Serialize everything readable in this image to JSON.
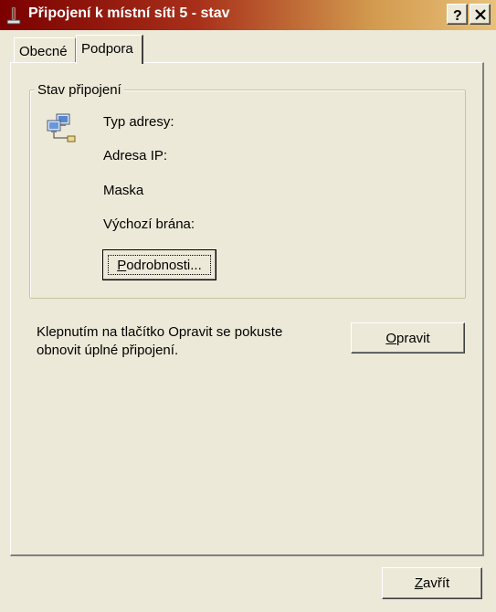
{
  "window": {
    "title": "Připojení k místní síti 5 - stav",
    "help_button": "?",
    "icon": "network-connection-icon"
  },
  "tabs": [
    {
      "label": "Obecné",
      "active": false
    },
    {
      "label": "Podpora",
      "active": true
    }
  ],
  "connection_status": {
    "group_title": "Stav připojení",
    "icon": "network-computers-icon",
    "fields": [
      {
        "label": "Typ adresy:"
      },
      {
        "label": "Adresa IP:"
      },
      {
        "label": "Maska"
      },
      {
        "label": "Výchozí brána:"
      }
    ],
    "details_button": {
      "underline": "P",
      "rest": "odrobnosti..."
    }
  },
  "repair": {
    "hint": "Klepnutím na tlačítko Opravit se pokuste obnovit úplné připojení.",
    "button": {
      "underline": "O",
      "rest": "pravit"
    }
  },
  "close_button": {
    "underline": "Z",
    "rest": "avřít"
  }
}
